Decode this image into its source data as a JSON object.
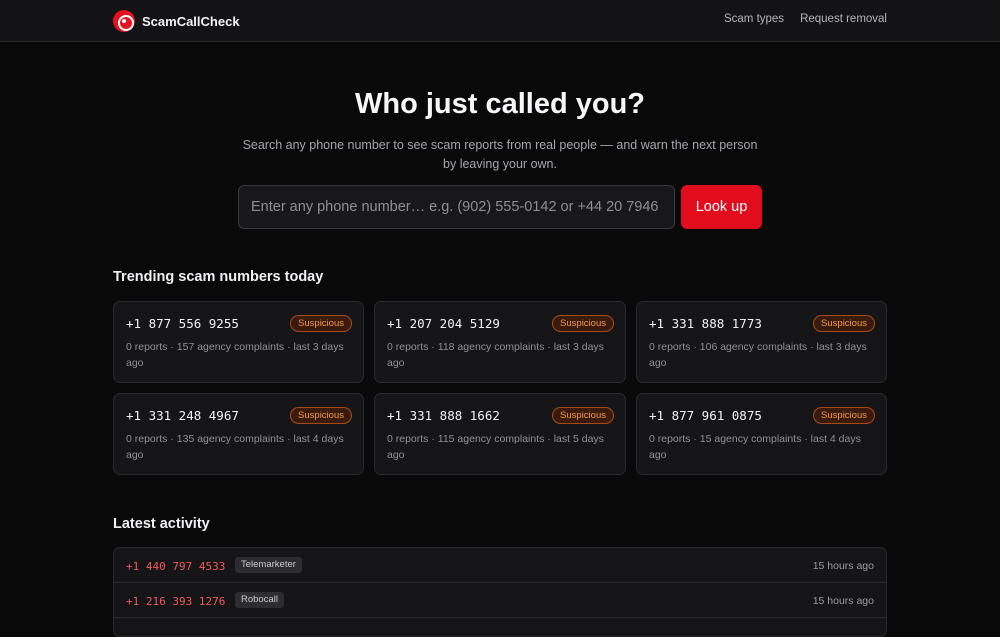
{
  "brand": {
    "name": "ScamCallCheck"
  },
  "nav": {
    "items": [
      "Scam types",
      "Request removal"
    ]
  },
  "hero": {
    "title": "Who just called you?",
    "subtitle": "Search any phone number to see scam reports from real people — and warn the next person by leaving your own.",
    "search_placeholder": "Enter any phone number… e.g. (902) 555-0142 or +44 20 7946",
    "button_label": "Look up"
  },
  "trending": {
    "title": "Trending scam numbers today",
    "cards": [
      {
        "number": "+1 877 556 9255",
        "badge": "Suspicious",
        "meta": "0 reports · 157 agency complaints · last 3 days ago"
      },
      {
        "number": "+1 207 204 5129",
        "badge": "Suspicious",
        "meta": "0 reports · 118 agency complaints · last 3 days ago"
      },
      {
        "number": "+1 331 888 1773",
        "badge": "Suspicious",
        "meta": "0 reports · 106 agency complaints · last 3 days ago"
      },
      {
        "number": "+1 331 248 4967",
        "badge": "Suspicious",
        "meta": "0 reports · 135 agency complaints · last 4 days ago"
      },
      {
        "number": "+1 331 888 1662",
        "badge": "Suspicious",
        "meta": "0 reports · 115 agency complaints · last 5 days ago"
      },
      {
        "number": "+1 877 961 0875",
        "badge": "Suspicious",
        "meta": "0 reports · 15 agency complaints · last 4 days ago"
      }
    ]
  },
  "activity": {
    "title": "Latest activity",
    "rows": [
      {
        "number": "+1 440 797 4533",
        "tag": "Telemarketer",
        "time": "15 hours ago"
      },
      {
        "number": "+1 216 393 1276",
        "tag": "Robocall",
        "time": "15 hours ago"
      }
    ]
  },
  "colors": {
    "accent": "#e10c1c",
    "badge_text": "#f29a4a",
    "activity_number": "#f05a5a"
  }
}
